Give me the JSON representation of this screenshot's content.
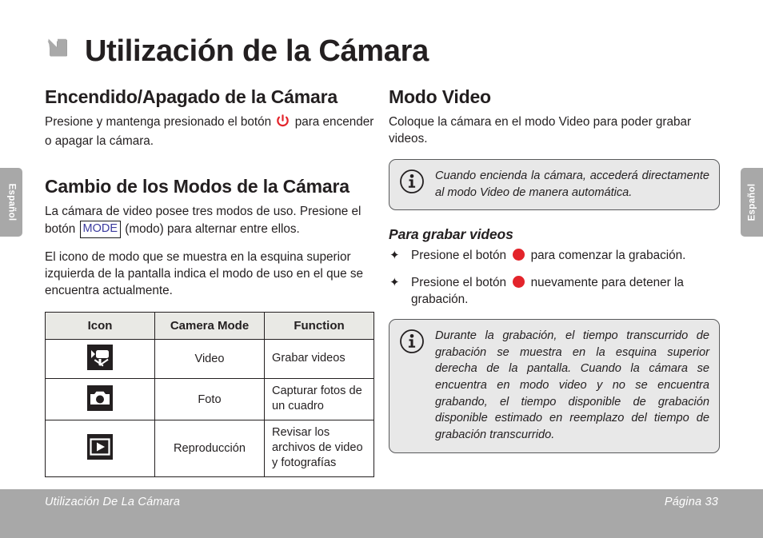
{
  "page": {
    "title": "Utilización de la Cámara",
    "title_arrow_icon": "arrow-down-right-icon"
  },
  "side_tabs": {
    "left_label": "Español",
    "right_label": "Español"
  },
  "left_column": {
    "section1": {
      "heading": "Encendido/Apagado de la Cámara",
      "para_before_icon": "Presione y mantenga presionado el botón",
      "power_icon": "power-icon",
      "para_after_icon": "para encender o apagar la cámara."
    },
    "section2": {
      "heading": "Cambio de los Modos de la Cámara",
      "para1_before_key": "La cámara de video posee tres modos de uso. Presione el botón",
      "mode_key_label": "MODE",
      "para1_after_key": "(modo) para alternar entre ellos.",
      "para2": "El icono de modo que se muestra en la esquina superior izquierda de la pantalla indica el modo de uso en el que se encuentra actualmente."
    },
    "table": {
      "headers": [
        "Icon",
        "Camera Mode",
        "Function"
      ],
      "rows": [
        {
          "icon": "video-camera-icon",
          "mode": "Video",
          "function": "Grabar videos"
        },
        {
          "icon": "photo-camera-icon",
          "mode": "Foto",
          "function": "Capturar fotos de un cuadro"
        },
        {
          "icon": "playback-icon",
          "mode": "Reproducción",
          "function": "Revisar los archivos de video y fotografías"
        }
      ]
    }
  },
  "right_column": {
    "section1": {
      "heading": "Modo Video",
      "para": "Coloque la cámara en el modo Video para poder grabar videos."
    },
    "note1": {
      "icon": "info-icon",
      "text": "Cuando encienda la cámara, accederá directamente al modo Video de manera automática."
    },
    "section2": {
      "heading": "Para grabar videos",
      "bullets": [
        {
          "mark": "✦",
          "before_dot": "Presione el botón",
          "dot_icon": "record-button-icon",
          "after_dot": "para comenzar la grabación."
        },
        {
          "mark": "✦",
          "before_dot": "Presione el botón",
          "dot_icon": "record-button-icon",
          "after_dot": "nuevamente para detener la grabación."
        }
      ]
    },
    "note2": {
      "icon": "info-icon",
      "text": "Durante la grabación, el tiempo transcurrido de grabación se muestra en la esquina superior derecha de la pantalla. Cuando la cámara se encuentra en modo video y no se encuentra grabando, el tiempo disponible de grabación disponible estimado en reemplazo del tiempo de grabación transcurrido."
    }
  },
  "footer": {
    "left": "Utilización De La Cámara",
    "right": "Página 33"
  },
  "colors": {
    "text": "#231f20",
    "band_gray": "#a8a8a8",
    "note_bg": "#e8e8e8",
    "table_header_bg": "#e9e9e5",
    "accent_red": "#e3242b",
    "mode_key_blue": "#3b3b9e",
    "arrow_gray": "#a0a0a0"
  }
}
